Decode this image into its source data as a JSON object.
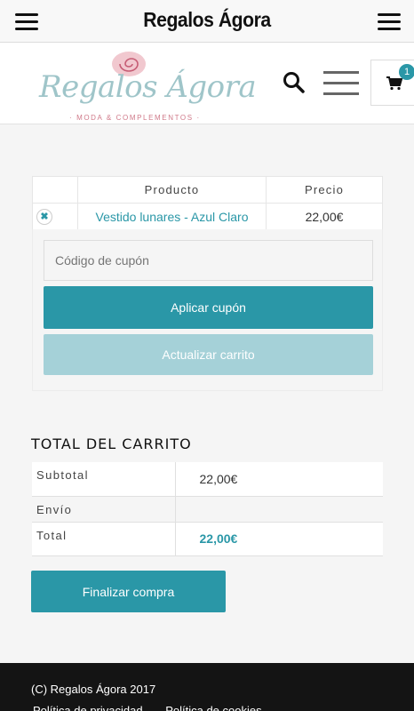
{
  "appbar": {
    "title": "Regalos Ágora"
  },
  "header": {
    "logo_text": "Regalos Ágora",
    "logo_tagline": "· MODA & COMPLEMENTOS ·",
    "cart_count": "1"
  },
  "cart": {
    "columns": {
      "product": "Producto",
      "price": "Precio"
    },
    "items": [
      {
        "remove": "✖",
        "product": "Vestido lunares - Azul Claro",
        "price": "22,00€"
      }
    ],
    "coupon_placeholder": "Código de cupón",
    "apply_label": "Aplicar cupón",
    "update_label": "Actualizar carrito"
  },
  "totals": {
    "title": "TOTAL DEL CARRITO",
    "subtotal_label": "Subtotal",
    "subtotal_value": "22,00€",
    "shipping_label": "Envío",
    "total_label": "Total",
    "total_value": "22,00€",
    "checkout_label": "Finalizar compra"
  },
  "footer": {
    "copyright": "(C) Regalos Ágora 2017",
    "links": [
      "Política de privacidad",
      "Política de cookies"
    ]
  },
  "colors": {
    "accent": "#2a97a7",
    "accent_light": "#a5d1d8",
    "footer_bg": "#141414"
  }
}
